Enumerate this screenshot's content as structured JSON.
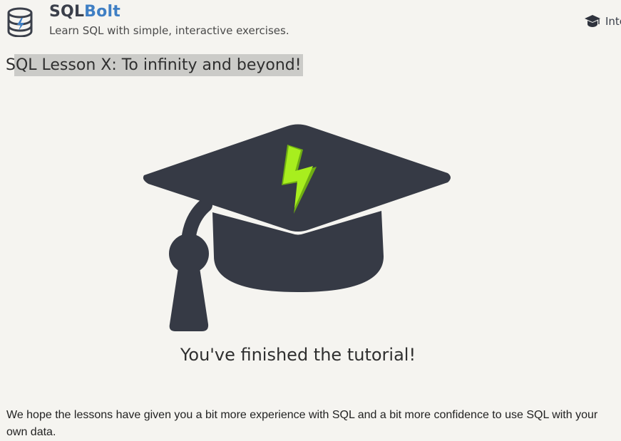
{
  "header": {
    "brand_prefix": "SQL",
    "brand_accent": "Bolt",
    "tagline": "Learn SQL with simple, interactive exercises.",
    "nav_label": "Interactive Tutorial",
    "logo_icon": "database-bolt-icon",
    "nav_icon": "graduation-cap-icon"
  },
  "lesson": {
    "title": "SQL Lesson X: To infinity and beyond!",
    "hero_icon": "graduation-cap-bolt-icon",
    "finished_message": "You've finished the tutorial!",
    "intro_text": "We hope the lessons have given you a bit more experience with SQL and a bit more confidence to use SQL with your own data."
  },
  "colors": {
    "background": "#f5f4f0",
    "brand_accent": "#3f7fc4",
    "cap_dark": "#363a45",
    "bolt_green": "#9be31a",
    "title_highlight": "#cbcbc8"
  }
}
